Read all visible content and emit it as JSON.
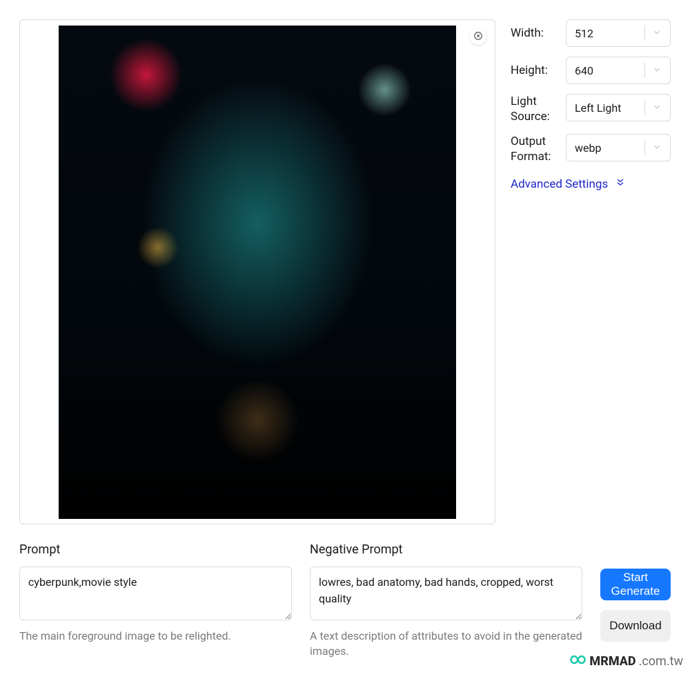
{
  "settings": {
    "width": {
      "label": "Width:",
      "value": "512"
    },
    "height": {
      "label": "Height:",
      "value": "640"
    },
    "light_source": {
      "label": "Light Source:",
      "value": "Left Light"
    },
    "output_format": {
      "label": "Output Format:",
      "value": "webp"
    },
    "advanced_label": "Advanced Settings"
  },
  "prompt": {
    "label": "Prompt",
    "value": "cyberpunk,movie style",
    "hint": "The main foreground image to be relighted."
  },
  "negative_prompt": {
    "label": "Negative Prompt",
    "value": "lowres, bad anatomy, bad hands, cropped, worst quality",
    "hint": "A text description of attributes to avoid in the generated images."
  },
  "buttons": {
    "generate": "Start Generate",
    "download": "Download"
  },
  "watermark": {
    "brand": "MRMAD",
    "domain": ".com.tw"
  }
}
